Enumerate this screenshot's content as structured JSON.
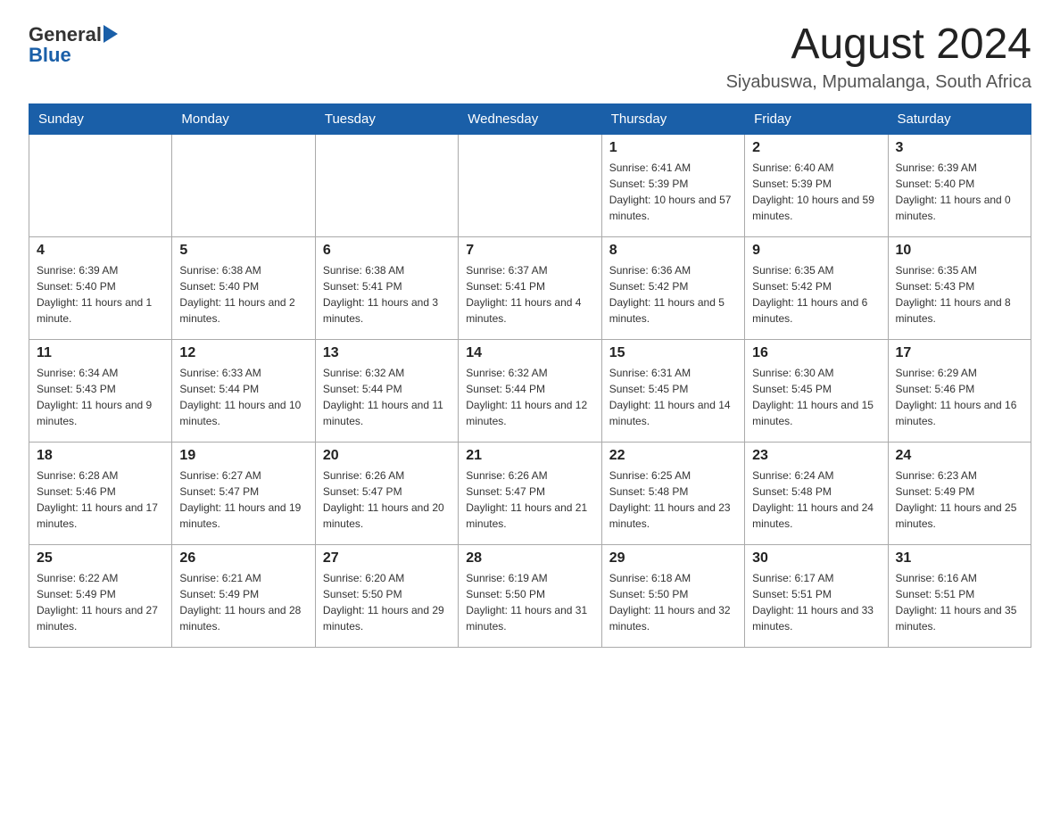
{
  "header": {
    "logo_general": "General",
    "logo_blue": "Blue",
    "month_title": "August 2024",
    "location": "Siyabuswa, Mpumalanga, South Africa"
  },
  "days_of_week": [
    "Sunday",
    "Monday",
    "Tuesday",
    "Wednesday",
    "Thursday",
    "Friday",
    "Saturday"
  ],
  "weeks": [
    [
      {
        "day": "",
        "sunrise": "",
        "sunset": "",
        "daylight": ""
      },
      {
        "day": "",
        "sunrise": "",
        "sunset": "",
        "daylight": ""
      },
      {
        "day": "",
        "sunrise": "",
        "sunset": "",
        "daylight": ""
      },
      {
        "day": "",
        "sunrise": "",
        "sunset": "",
        "daylight": ""
      },
      {
        "day": "1",
        "sunrise": "Sunrise: 6:41 AM",
        "sunset": "Sunset: 5:39 PM",
        "daylight": "Daylight: 10 hours and 57 minutes."
      },
      {
        "day": "2",
        "sunrise": "Sunrise: 6:40 AM",
        "sunset": "Sunset: 5:39 PM",
        "daylight": "Daylight: 10 hours and 59 minutes."
      },
      {
        "day": "3",
        "sunrise": "Sunrise: 6:39 AM",
        "sunset": "Sunset: 5:40 PM",
        "daylight": "Daylight: 11 hours and 0 minutes."
      }
    ],
    [
      {
        "day": "4",
        "sunrise": "Sunrise: 6:39 AM",
        "sunset": "Sunset: 5:40 PM",
        "daylight": "Daylight: 11 hours and 1 minute."
      },
      {
        "day": "5",
        "sunrise": "Sunrise: 6:38 AM",
        "sunset": "Sunset: 5:40 PM",
        "daylight": "Daylight: 11 hours and 2 minutes."
      },
      {
        "day": "6",
        "sunrise": "Sunrise: 6:38 AM",
        "sunset": "Sunset: 5:41 PM",
        "daylight": "Daylight: 11 hours and 3 minutes."
      },
      {
        "day": "7",
        "sunrise": "Sunrise: 6:37 AM",
        "sunset": "Sunset: 5:41 PM",
        "daylight": "Daylight: 11 hours and 4 minutes."
      },
      {
        "day": "8",
        "sunrise": "Sunrise: 6:36 AM",
        "sunset": "Sunset: 5:42 PM",
        "daylight": "Daylight: 11 hours and 5 minutes."
      },
      {
        "day": "9",
        "sunrise": "Sunrise: 6:35 AM",
        "sunset": "Sunset: 5:42 PM",
        "daylight": "Daylight: 11 hours and 6 minutes."
      },
      {
        "day": "10",
        "sunrise": "Sunrise: 6:35 AM",
        "sunset": "Sunset: 5:43 PM",
        "daylight": "Daylight: 11 hours and 8 minutes."
      }
    ],
    [
      {
        "day": "11",
        "sunrise": "Sunrise: 6:34 AM",
        "sunset": "Sunset: 5:43 PM",
        "daylight": "Daylight: 11 hours and 9 minutes."
      },
      {
        "day": "12",
        "sunrise": "Sunrise: 6:33 AM",
        "sunset": "Sunset: 5:44 PM",
        "daylight": "Daylight: 11 hours and 10 minutes."
      },
      {
        "day": "13",
        "sunrise": "Sunrise: 6:32 AM",
        "sunset": "Sunset: 5:44 PM",
        "daylight": "Daylight: 11 hours and 11 minutes."
      },
      {
        "day": "14",
        "sunrise": "Sunrise: 6:32 AM",
        "sunset": "Sunset: 5:44 PM",
        "daylight": "Daylight: 11 hours and 12 minutes."
      },
      {
        "day": "15",
        "sunrise": "Sunrise: 6:31 AM",
        "sunset": "Sunset: 5:45 PM",
        "daylight": "Daylight: 11 hours and 14 minutes."
      },
      {
        "day": "16",
        "sunrise": "Sunrise: 6:30 AM",
        "sunset": "Sunset: 5:45 PM",
        "daylight": "Daylight: 11 hours and 15 minutes."
      },
      {
        "day": "17",
        "sunrise": "Sunrise: 6:29 AM",
        "sunset": "Sunset: 5:46 PM",
        "daylight": "Daylight: 11 hours and 16 minutes."
      }
    ],
    [
      {
        "day": "18",
        "sunrise": "Sunrise: 6:28 AM",
        "sunset": "Sunset: 5:46 PM",
        "daylight": "Daylight: 11 hours and 17 minutes."
      },
      {
        "day": "19",
        "sunrise": "Sunrise: 6:27 AM",
        "sunset": "Sunset: 5:47 PM",
        "daylight": "Daylight: 11 hours and 19 minutes."
      },
      {
        "day": "20",
        "sunrise": "Sunrise: 6:26 AM",
        "sunset": "Sunset: 5:47 PM",
        "daylight": "Daylight: 11 hours and 20 minutes."
      },
      {
        "day": "21",
        "sunrise": "Sunrise: 6:26 AM",
        "sunset": "Sunset: 5:47 PM",
        "daylight": "Daylight: 11 hours and 21 minutes."
      },
      {
        "day": "22",
        "sunrise": "Sunrise: 6:25 AM",
        "sunset": "Sunset: 5:48 PM",
        "daylight": "Daylight: 11 hours and 23 minutes."
      },
      {
        "day": "23",
        "sunrise": "Sunrise: 6:24 AM",
        "sunset": "Sunset: 5:48 PM",
        "daylight": "Daylight: 11 hours and 24 minutes."
      },
      {
        "day": "24",
        "sunrise": "Sunrise: 6:23 AM",
        "sunset": "Sunset: 5:49 PM",
        "daylight": "Daylight: 11 hours and 25 minutes."
      }
    ],
    [
      {
        "day": "25",
        "sunrise": "Sunrise: 6:22 AM",
        "sunset": "Sunset: 5:49 PM",
        "daylight": "Daylight: 11 hours and 27 minutes."
      },
      {
        "day": "26",
        "sunrise": "Sunrise: 6:21 AM",
        "sunset": "Sunset: 5:49 PM",
        "daylight": "Daylight: 11 hours and 28 minutes."
      },
      {
        "day": "27",
        "sunrise": "Sunrise: 6:20 AM",
        "sunset": "Sunset: 5:50 PM",
        "daylight": "Daylight: 11 hours and 29 minutes."
      },
      {
        "day": "28",
        "sunrise": "Sunrise: 6:19 AM",
        "sunset": "Sunset: 5:50 PM",
        "daylight": "Daylight: 11 hours and 31 minutes."
      },
      {
        "day": "29",
        "sunrise": "Sunrise: 6:18 AM",
        "sunset": "Sunset: 5:50 PM",
        "daylight": "Daylight: 11 hours and 32 minutes."
      },
      {
        "day": "30",
        "sunrise": "Sunrise: 6:17 AM",
        "sunset": "Sunset: 5:51 PM",
        "daylight": "Daylight: 11 hours and 33 minutes."
      },
      {
        "day": "31",
        "sunrise": "Sunrise: 6:16 AM",
        "sunset": "Sunset: 5:51 PM",
        "daylight": "Daylight: 11 hours and 35 minutes."
      }
    ]
  ]
}
